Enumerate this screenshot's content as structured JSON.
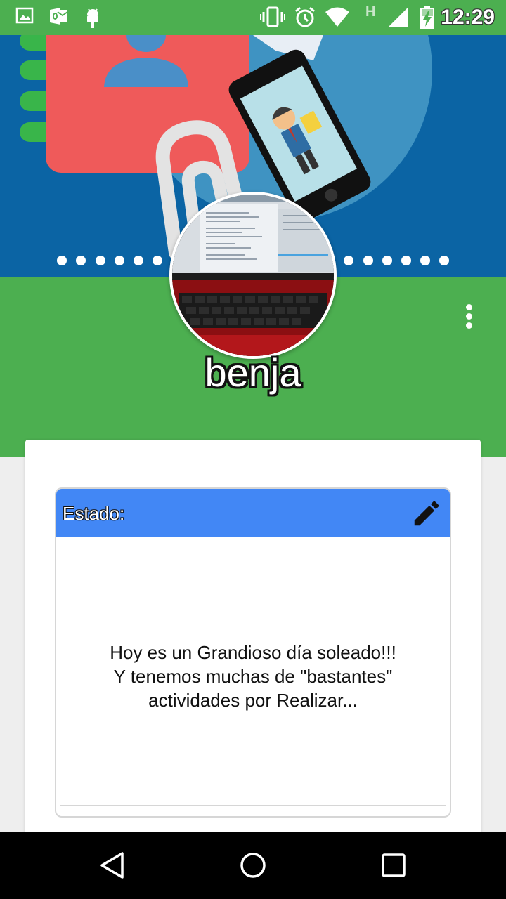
{
  "status_bar": {
    "time": "12:29",
    "network_type": "H",
    "icons": [
      "image-icon",
      "outlook-icon",
      "android-icon",
      "vibrate-icon",
      "alarm-icon",
      "wifi-icon",
      "signal-icon",
      "battery-charging-icon"
    ]
  },
  "profile": {
    "username": "benja",
    "carousel_dots": 12
  },
  "status_card": {
    "label": "Estado:",
    "message": "Hoy es un Grandioso día soleado!!!\nY tenemos muchas de \"bastantes\"\nactividades por Realizar..."
  },
  "colors": {
    "primary_green": "#4caf50",
    "banner_blue": "#0b64a4",
    "status_header_blue": "#4287f5"
  },
  "nav_bar": {
    "icons": [
      "back-icon",
      "home-icon",
      "recents-icon"
    ]
  }
}
